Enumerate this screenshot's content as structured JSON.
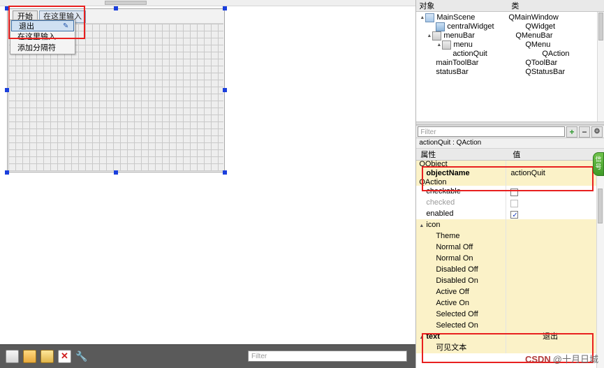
{
  "designer": {
    "menubar": {
      "start_label": "开始",
      "hint_label": "在这里输入"
    },
    "dropdown": {
      "items": [
        {
          "label": "退出",
          "selected": true,
          "icon": "pencil-icon"
        },
        {
          "label": "在这里输入",
          "selected": false,
          "icon": ""
        },
        {
          "label": "添加分隔符",
          "selected": false,
          "icon": ""
        }
      ]
    },
    "bottom_toolbar": {
      "icons": [
        "new-file-icon",
        "open-folder-icon",
        "save-icon",
        "delete-icon",
        "wrench-icon"
      ],
      "filter_placeholder": "Filter"
    }
  },
  "object_inspector": {
    "header": {
      "col_object": "对象",
      "col_class": "类"
    },
    "rows": [
      {
        "indent": 0,
        "arrow": "▲",
        "icon": "window-icon",
        "name": "MainScene",
        "class": "QMainWindow"
      },
      {
        "indent": 1,
        "arrow": "",
        "icon": "widget-icon",
        "name": "centralWidget",
        "class": "QWidget"
      },
      {
        "indent": 1,
        "arrow": "▲",
        "icon": "menubar-icon",
        "name": "menuBar",
        "class": "QMenuBar"
      },
      {
        "indent": 2,
        "arrow": "▲",
        "icon": "menu-icon",
        "name": "menu",
        "class": "QMenu"
      },
      {
        "indent": 3,
        "arrow": "",
        "icon": "action-icon",
        "name": "actionQuit",
        "class": "QAction"
      },
      {
        "indent": 1,
        "arrow": "",
        "icon": "toolbar-icon",
        "name": "mainToolBar",
        "class": "QToolBar"
      },
      {
        "indent": 1,
        "arrow": "",
        "icon": "statusbar-icon",
        "name": "statusBar",
        "class": "QStatusBar"
      }
    ]
  },
  "property_filter": {
    "placeholder": "Filter",
    "add_button": "+",
    "remove_button": "−",
    "config_button": "⚙"
  },
  "selected_object": "actionQuit : QAction",
  "property_editor": {
    "header": {
      "col_property": "属性",
      "col_value": "值"
    },
    "rows": [
      {
        "name": "QObject",
        "value": "",
        "style": "group-cut",
        "arrow": "▲"
      },
      {
        "name": "objectName",
        "value": "actionQuit",
        "style": "bold-yellow"
      },
      {
        "name": "QAction",
        "value": "",
        "style": "group-cut2",
        "arrow": "▲"
      },
      {
        "name": "checkable",
        "value": "",
        "style": "checkbox-off"
      },
      {
        "name": "checked",
        "value": "",
        "style": "checkbox-disabled"
      },
      {
        "name": "enabled",
        "value": "",
        "style": "checkbox-on"
      },
      {
        "name": "icon",
        "value": "",
        "style": "group",
        "arrow": "▲"
      },
      {
        "name": "Theme",
        "value": "",
        "style": "plain"
      },
      {
        "name": "Normal Off",
        "value": "",
        "style": "yellow"
      },
      {
        "name": "Normal On",
        "value": "",
        "style": "plain"
      },
      {
        "name": "Disabled Off",
        "value": "",
        "style": "yellow"
      },
      {
        "name": "Disabled On",
        "value": "",
        "style": "plain"
      },
      {
        "name": "Active Off",
        "value": "",
        "style": "yellow"
      },
      {
        "name": "Active On",
        "value": "",
        "style": "plain"
      },
      {
        "name": "Selected Off",
        "value": "",
        "style": "yellow"
      },
      {
        "name": "Selected On",
        "value": "",
        "style": "plain"
      },
      {
        "name": "text",
        "value": "退出",
        "style": "bold-yellow",
        "arrow": "▲"
      },
      {
        "name": "可见文本",
        "value": "",
        "style": "plain"
      }
    ]
  },
  "side_tab": {
    "label": "信号"
  },
  "watermark": {
    "brand": "CSDN",
    "author": "@十月日城"
  },
  "colors": {
    "highlight_red": "#e8201f",
    "yellow_row": "#fbf2c8",
    "selection_blue": "#cfe0f2",
    "panel_bg": "#f0f0f0",
    "dark_bar": "#5a5a5a"
  }
}
